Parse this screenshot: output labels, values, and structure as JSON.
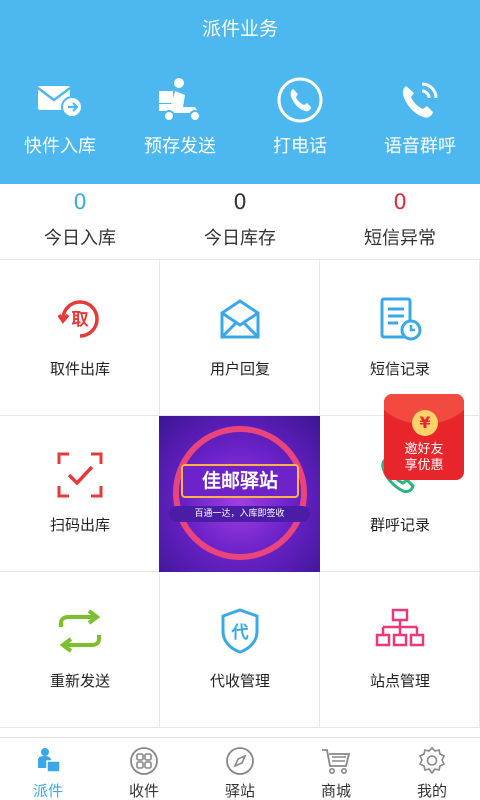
{
  "header": {
    "title": "派件业务",
    "actions": [
      {
        "label": "快件入库",
        "icon": "mail-inbound-icon"
      },
      {
        "label": "预存发送",
        "icon": "delivery-scooter-icon"
      },
      {
        "label": "打电话",
        "icon": "phone-icon"
      },
      {
        "label": "语音群呼",
        "icon": "voice-call-icon"
      }
    ]
  },
  "stats": [
    {
      "value": "0",
      "label": "今日入库",
      "color": "#3aa8e8"
    },
    {
      "value": "0",
      "label": "今日库存",
      "color": "#333333"
    },
    {
      "value": "0",
      "label": "短信异常",
      "color": "#e0283a"
    }
  ],
  "grid": {
    "items": [
      {
        "label": "取件出库",
        "icon": "pickup-out-icon"
      },
      {
        "label": "用户回复",
        "icon": "envelope-icon"
      },
      {
        "label": "短信记录",
        "icon": "sms-record-icon"
      },
      {
        "label": "扫码出库",
        "icon": "scan-code-icon"
      },
      {
        "label": "群呼记录",
        "icon": "call-record-icon"
      },
      {
        "label": "重新发送",
        "icon": "resend-icon"
      },
      {
        "label": "代收管理",
        "icon": "collection-shield-icon"
      },
      {
        "label": "站点管理",
        "icon": "station-tree-icon"
      }
    ],
    "banner": {
      "title": "佳邮驿站",
      "subtitle": "百通一达，入库即签收"
    },
    "promo": {
      "coin": "¥",
      "line1": "邀好友",
      "line2": "享优惠"
    }
  },
  "nav": {
    "tabs": [
      {
        "label": "派件",
        "icon": "parcel-courier-icon",
        "active": true
      },
      {
        "label": "收件",
        "icon": "grid-circle-icon",
        "active": false
      },
      {
        "label": "驿站",
        "icon": "compass-icon",
        "active": false
      },
      {
        "label": "商城",
        "icon": "cart-icon",
        "active": false
      },
      {
        "label": "我的",
        "icon": "gear-icon",
        "active": false
      }
    ]
  },
  "colors": {
    "header_bg": "#4db8f0",
    "accent": "#3aa8e8",
    "alert": "#e0283a"
  }
}
